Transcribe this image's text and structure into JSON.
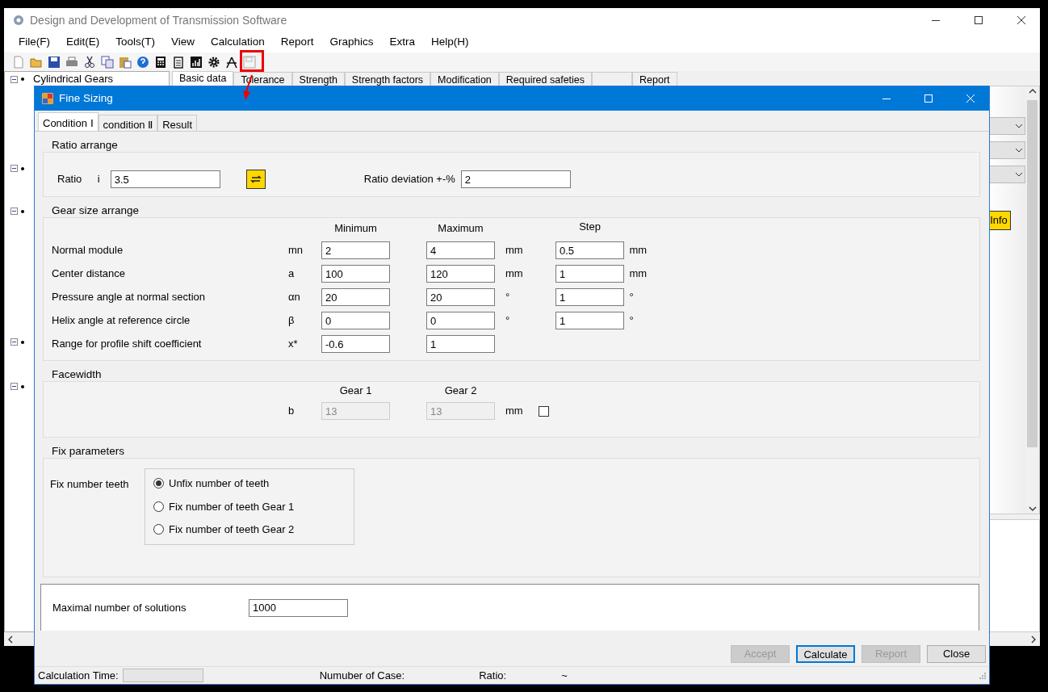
{
  "app": {
    "title": "Design and Development of Transmission Software",
    "menu": [
      "File(F)",
      "Edit(E)",
      "Tools(T)",
      "View",
      "Calculation",
      "Report",
      "Graphics",
      "Extra",
      "Help(H)"
    ],
    "tree": [
      {
        "label": "Cylindrical Gears",
        "expanded": true
      },
      {
        "expanded": true
      },
      {
        "expanded": true
      },
      {
        "expanded": true
      },
      {
        "expanded": true
      }
    ],
    "tabs": [
      {
        "label": "Basic data",
        "selected": true
      },
      {
        "label": "Tolerance",
        "selected": false
      },
      {
        "label": "Strength",
        "selected": false
      },
      {
        "label": "Strength factors",
        "selected": false
      },
      {
        "label": "Modification",
        "selected": false
      },
      {
        "label": "Required safeties",
        "selected": false
      },
      {
        "selected": false
      },
      {
        "label": "Report",
        "selected": false
      }
    ],
    "info_button": "Info"
  },
  "dialog": {
    "title": "Fine Sizing",
    "tabs": [
      {
        "label": "Condition Ⅰ",
        "selected": true
      },
      {
        "label": "condition Ⅱ",
        "selected": false
      },
      {
        "label": "Result",
        "selected": false
      }
    ],
    "ratio_group": {
      "title": "Ratio arrange",
      "ratio_label": "Ratio",
      "ratio_symbol": "i",
      "ratio_value": "3.5",
      "deviation_label": "Ratio deviation +-%",
      "deviation_value": "2"
    },
    "size_group": {
      "title": "Gear size arrange",
      "headers": [
        "Minimum",
        "Maximum",
        "Step"
      ],
      "rows": [
        {
          "label": "Normal module",
          "symbol": "mn",
          "min": "2",
          "max": "4",
          "unit": "mm",
          "step": "0.5",
          "step_unit": "mm"
        },
        {
          "label": "Center distance",
          "symbol": "a",
          "min": "100",
          "max": "120",
          "unit": "mm",
          "step": "1",
          "step_unit": "mm"
        },
        {
          "label": "Pressure angle at normal section",
          "symbol": "αn",
          "min": "20",
          "max": "20",
          "unit": "°",
          "step": "1",
          "step_unit": "°"
        },
        {
          "label": "Helix angle at reference circle",
          "symbol": "β",
          "min": "0",
          "max": "0",
          "unit": "°",
          "step": "1",
          "step_unit": "°"
        },
        {
          "label": "Range for profile shift coefficient",
          "symbol": "x*",
          "min": "-0.6",
          "max": "1"
        }
      ]
    },
    "facewidth": {
      "title": "Facewidth",
      "headers": [
        "Gear 1",
        "Gear 2"
      ],
      "symbol": "b",
      "gear1": "13",
      "gear2": "13",
      "disabled": true,
      "unit": "mm",
      "checked": false
    },
    "fix_group": {
      "title": "Fix parameters",
      "label": "Fix number teeth",
      "options": [
        {
          "label": "Unfix number of teeth",
          "selected": true
        },
        {
          "label": "Fix number of teeth Gear 1",
          "selected": false
        },
        {
          "label": "Fix number of teeth Gear 2",
          "selected": false
        }
      ]
    },
    "max_solutions": {
      "label": "Maximal number of solutions",
      "value": "1000"
    },
    "buttons": [
      {
        "label": "Accept",
        "disabled": true,
        "default": false
      },
      {
        "label": "Calculate",
        "disabled": false,
        "default": true
      },
      {
        "label": "Report",
        "disabled": true,
        "default": false
      },
      {
        "label": "Close",
        "disabled": false,
        "default": false
      }
    ],
    "status": {
      "time_label": "Calculation Time:",
      "cases_label": "Numuber of Case:",
      "ratio_label": "Ratio:",
      "ratio_value": "~"
    }
  }
}
